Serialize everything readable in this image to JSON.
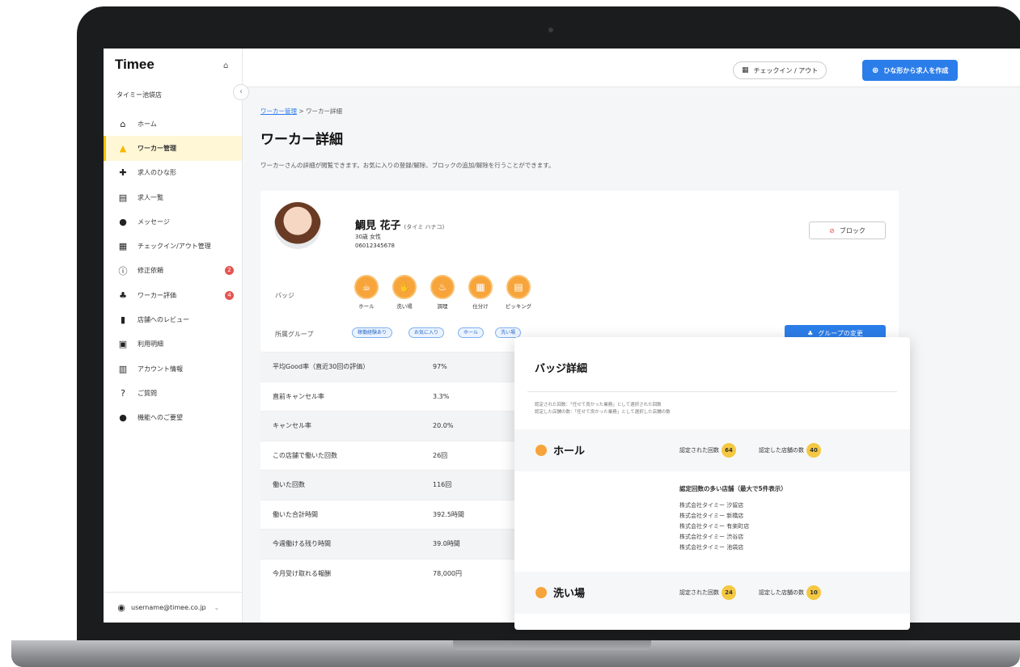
{
  "app": {
    "logo": "Timee",
    "store_name": "タイミー池袋店"
  },
  "sidebar": {
    "collapse": "‹",
    "items": [
      {
        "label": "ホーム",
        "icon": "home-icon",
        "glyph": "⌂"
      },
      {
        "label": "ワーカー管理",
        "icon": "bell-icon",
        "glyph": "▲"
      },
      {
        "label": "求人のひな形",
        "icon": "plus-circle-icon",
        "glyph": "✚"
      },
      {
        "label": "求人一覧",
        "icon": "list-icon",
        "glyph": "▤"
      },
      {
        "label": "メッセージ",
        "icon": "chat-icon",
        "glyph": "●"
      },
      {
        "label": "チェックイン/アウト管理",
        "icon": "qr-icon",
        "glyph": "▦"
      },
      {
        "label": "修正依頼",
        "icon": "info-icon",
        "glyph": "ⓘ",
        "badge": "2"
      },
      {
        "label": "ワーカー評価",
        "icon": "users-icon",
        "glyph": "♣",
        "badge": "4"
      },
      {
        "label": "店舗へのレビュー",
        "icon": "thumbs-up-icon",
        "glyph": "▮"
      },
      {
        "label": "利用明細",
        "icon": "document-icon",
        "glyph": "▣"
      },
      {
        "label": "アカウント情報",
        "icon": "store-icon",
        "glyph": "▥"
      },
      {
        "label": "ご質問",
        "icon": "help-icon",
        "glyph": "?"
      },
      {
        "label": "機能へのご要望",
        "icon": "lightbulb-icon",
        "glyph": "●"
      }
    ],
    "user_email": "username@timee.co.jp"
  },
  "topbar": {
    "checkin_label": "チェックイン / アウト",
    "create_label": "ひな形から求人を作成"
  },
  "breadcrumb": {
    "parent": "ワーカー管理",
    "separator": " > ",
    "current": "ワーカー詳細"
  },
  "page": {
    "title": "ワーカー詳細",
    "description": "ワーカーさんの詳細が閲覧できます。お気に入りの登録/解除、ブロックの追加/解除を行うことができます。"
  },
  "worker": {
    "name": "鯛見 花子",
    "kana": "(タイミ ハナコ)",
    "age_gender": "30歳 女性",
    "phone": "06012345678",
    "block_label": "ブロック"
  },
  "badges": {
    "label": "バッジ",
    "items": [
      "ホール",
      "洗い場",
      "調理",
      "仕分け",
      "ピッキング"
    ]
  },
  "groups": {
    "label": "所属グループ",
    "tags": [
      "稼働経験あり",
      "お気に入り",
      "ホール",
      "洗い場"
    ],
    "change_label": "グループの変更"
  },
  "stats": [
    {
      "label": "平均Good率（直近30回の評価）",
      "value": "97%"
    },
    {
      "label": "直前キャンセル率",
      "value": "3.3%"
    },
    {
      "label": "キャンセル率",
      "value": "20.0%"
    },
    {
      "label": "この店舗で働いた回数",
      "value": "26回"
    },
    {
      "label": "働いた回数",
      "value": "116回"
    },
    {
      "label": "働いた合計時間",
      "value": "392.5時間"
    },
    {
      "label": "今週働ける残り時間",
      "value": "39.0時間"
    },
    {
      "label": "今月受け取れる報酬",
      "value": "78,000円"
    }
  ],
  "popup": {
    "title": "バッジ詳細",
    "note_line1": "認定された回数：「任せて良かった業務」として選択された回数",
    "note_line2": "認定した店舗の数：「任せて良かった業務」として選択した店舗の数",
    "categories": [
      {
        "name": "ホール",
        "count_label": "認定された回数",
        "count": "64",
        "stores_label": "認定した店舗の数",
        "stores": "40"
      },
      {
        "name": "洗い場",
        "count_label": "認定された回数",
        "count": "24",
        "stores_label": "認定した店舗の数",
        "stores": "10"
      }
    ],
    "stores_heading": "認定回数の多い店舗（最大で5件表示）",
    "stores": [
      "株式会社タイミー 汐留店",
      "株式会社タイミー 新橋店",
      "株式会社タイミー 有楽町店",
      "株式会社タイミー 渋谷店",
      "株式会社タイミー 池袋店"
    ]
  }
}
